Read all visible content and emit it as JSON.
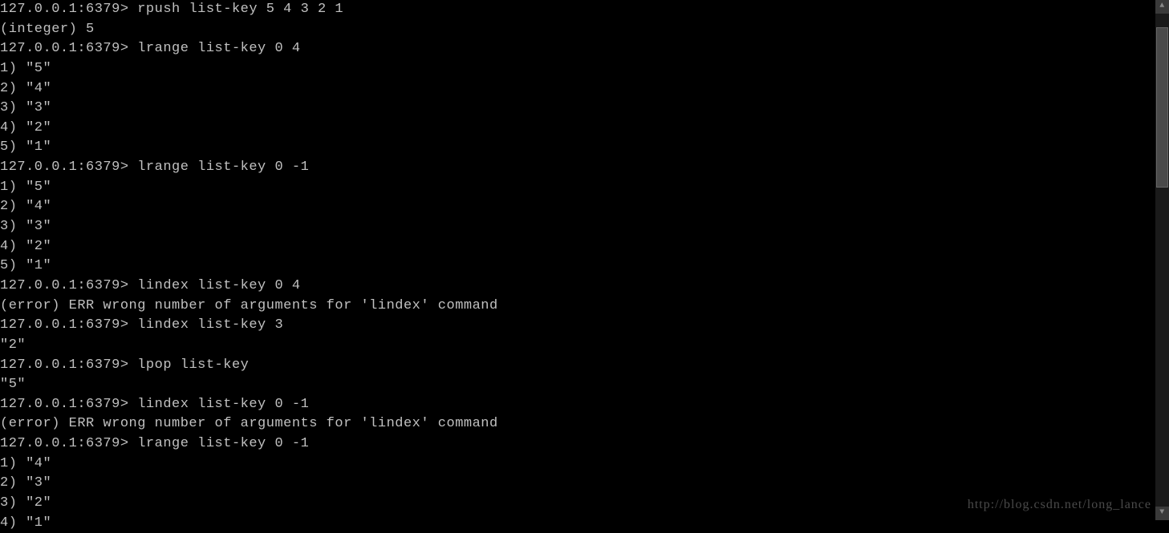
{
  "terminal": {
    "lines": [
      {
        "type": "cmd",
        "prompt": "127.0.0.1:6379>",
        "command": "rpush list-key 5 4 3 2 1"
      },
      {
        "type": "out",
        "text": "(integer) 5"
      },
      {
        "type": "cmd",
        "prompt": "127.0.0.1:6379>",
        "command": "lrange list-key 0 4"
      },
      {
        "type": "out",
        "text": "1) \"5\""
      },
      {
        "type": "out",
        "text": "2) \"4\""
      },
      {
        "type": "out",
        "text": "3) \"3\""
      },
      {
        "type": "out",
        "text": "4) \"2\""
      },
      {
        "type": "out",
        "text": "5) \"1\""
      },
      {
        "type": "cmd",
        "prompt": "127.0.0.1:6379>",
        "command": "lrange list-key 0 -1"
      },
      {
        "type": "out",
        "text": "1) \"5\""
      },
      {
        "type": "out",
        "text": "2) \"4\""
      },
      {
        "type": "out",
        "text": "3) \"3\""
      },
      {
        "type": "out",
        "text": "4) \"2\""
      },
      {
        "type": "out",
        "text": "5) \"1\""
      },
      {
        "type": "cmd",
        "prompt": "127.0.0.1:6379>",
        "command": "lindex list-key 0 4"
      },
      {
        "type": "out",
        "text": "(error) ERR wrong number of arguments for 'lindex' command"
      },
      {
        "type": "cmd",
        "prompt": "127.0.0.1:6379>",
        "command": "lindex list-key 3"
      },
      {
        "type": "out",
        "text": "\"2\""
      },
      {
        "type": "cmd",
        "prompt": "127.0.0.1:6379>",
        "command": "lpop list-key"
      },
      {
        "type": "out",
        "text": "\"5\""
      },
      {
        "type": "cmd",
        "prompt": "127.0.0.1:6379>",
        "command": "lindex list-key 0 -1"
      },
      {
        "type": "out",
        "text": "(error) ERR wrong number of arguments for 'lindex' command"
      },
      {
        "type": "cmd",
        "prompt": "127.0.0.1:6379>",
        "command": "lrange list-key 0 -1"
      },
      {
        "type": "out",
        "text": "1) \"4\""
      },
      {
        "type": "out",
        "text": "2) \"3\""
      },
      {
        "type": "out",
        "text": "3) \"2\""
      },
      {
        "type": "out",
        "text": "4) \"1\""
      }
    ]
  },
  "watermark": "http://blog.csdn.net/long_lance"
}
